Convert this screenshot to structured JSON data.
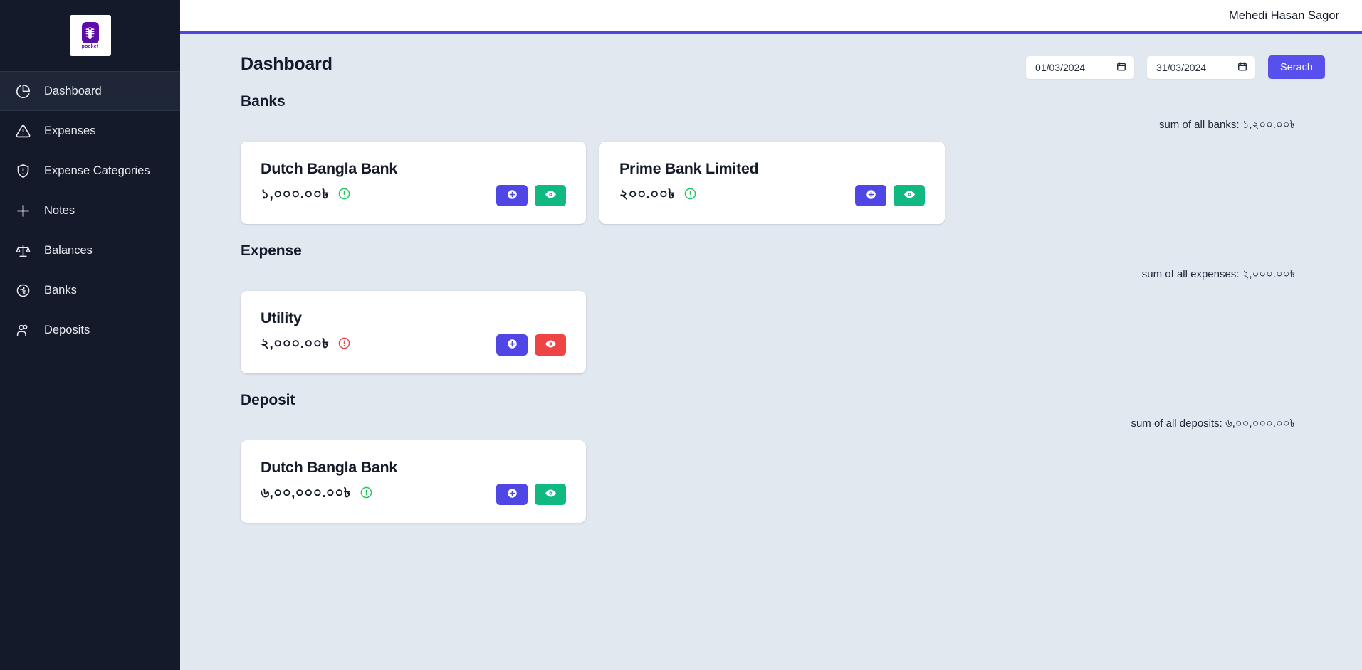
{
  "sidebar": {
    "logo": {
      "mark_icon": "pocket-logo-mark",
      "text": "pocket"
    },
    "items": [
      {
        "label": "Dashboard",
        "icon": "pie-chart-icon",
        "active": true
      },
      {
        "label": "Expenses",
        "icon": "alert-triangle-icon",
        "active": false
      },
      {
        "label": "Expense Categories",
        "icon": "shield-alert-icon",
        "active": false
      },
      {
        "label": "Notes",
        "icon": "plus-icon",
        "active": false
      },
      {
        "label": "Balances",
        "icon": "scales-icon",
        "active": false
      },
      {
        "label": "Banks",
        "icon": "taka-circle-icon",
        "active": false
      },
      {
        "label": "Deposits",
        "icon": "users-icon",
        "active": false
      }
    ]
  },
  "topbar": {
    "username": "Mehedi Hasan Sagor"
  },
  "page": {
    "title": "Dashboard"
  },
  "filter": {
    "start_date_value": "01/03/2024",
    "end_date_value": "31/03/2024",
    "start_date_placeholder": "dd/mm/yyyy",
    "end_date_placeholder": "dd/mm/yyyy",
    "calendar_icon": "calendar-icon",
    "search_label": "Serach"
  },
  "colors": {
    "sidebar_bg": "#141a2a",
    "page_bg": "#e2e8f0",
    "accent_indigo": "#4f46e5",
    "button_indigo": "#5850ec",
    "green": "#10b981",
    "red": "#ef4444",
    "status_green": "#22c55e",
    "status_red": "#ef4444"
  },
  "sections": [
    {
      "heading": "Banks",
      "summary": "sum of all banks: ১,২০০.০০৳",
      "cards": [
        {
          "title": "Dutch Bangla Bank",
          "amount": "১,০০০.০০৳",
          "status_icon": "alert-circle-icon",
          "status_color": "#22c55e",
          "add_icon": "plus-circle-icon",
          "view_icon": "eye-icon",
          "view_color": "#10b981"
        },
        {
          "title": "Prime Bank Limited",
          "amount": "২০০.০০৳",
          "status_icon": "alert-circle-icon",
          "status_color": "#22c55e",
          "add_icon": "plus-circle-icon",
          "view_icon": "eye-icon",
          "view_color": "#10b981"
        }
      ]
    },
    {
      "heading": "Expense",
      "summary": "sum of all expenses: ২,০০০.০০৳",
      "cards": [
        {
          "title": "Utility",
          "amount": "২,০০০.০০৳",
          "status_icon": "alert-circle-icon",
          "status_color": "#ef4444",
          "add_icon": "plus-circle-icon",
          "view_icon": "eye-icon",
          "view_color": "#ef4444"
        }
      ]
    },
    {
      "heading": "Deposit",
      "summary": "sum of all deposits: ৬,০০,০০০.০০৳",
      "cards": [
        {
          "title": "Dutch Bangla Bank",
          "amount": "৬,০০,০০০.০০৳",
          "status_icon": "alert-circle-icon",
          "status_color": "#22c55e",
          "add_icon": "plus-circle-icon",
          "view_icon": "eye-icon",
          "view_color": "#10b981"
        }
      ]
    }
  ]
}
